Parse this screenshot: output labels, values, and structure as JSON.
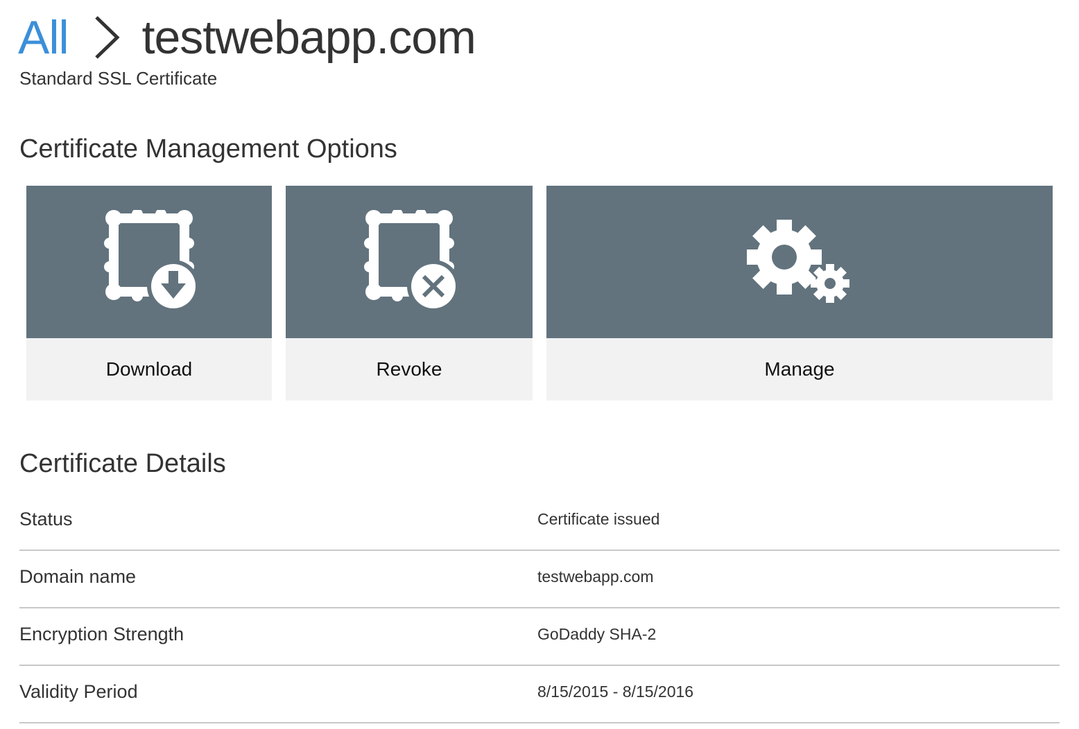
{
  "breadcrumb": {
    "root_label": "All",
    "current_label": "testwebapp.com"
  },
  "subtitle": "Standard SSL Certificate",
  "management": {
    "title": "Certificate Management Options",
    "options": [
      {
        "label": "Download",
        "icon": "certificate-download-icon"
      },
      {
        "label": "Revoke",
        "icon": "certificate-revoke-icon"
      },
      {
        "label": "Manage",
        "icon": "gears-icon"
      }
    ]
  },
  "details": {
    "title": "Certificate Details",
    "rows": [
      {
        "label": "Status",
        "value": "Certificate issued"
      },
      {
        "label": "Domain name",
        "value": "testwebapp.com"
      },
      {
        "label": "Encryption Strength",
        "value": "GoDaddy SHA-2"
      },
      {
        "label": "Validity Period",
        "value": "8/15/2015 - 8/15/2016"
      }
    ]
  },
  "colors": {
    "link": "#3b8fd9",
    "tile_top": "#62737d",
    "tile_bottom": "#f2f2f2",
    "divider": "#c8c8c8"
  }
}
